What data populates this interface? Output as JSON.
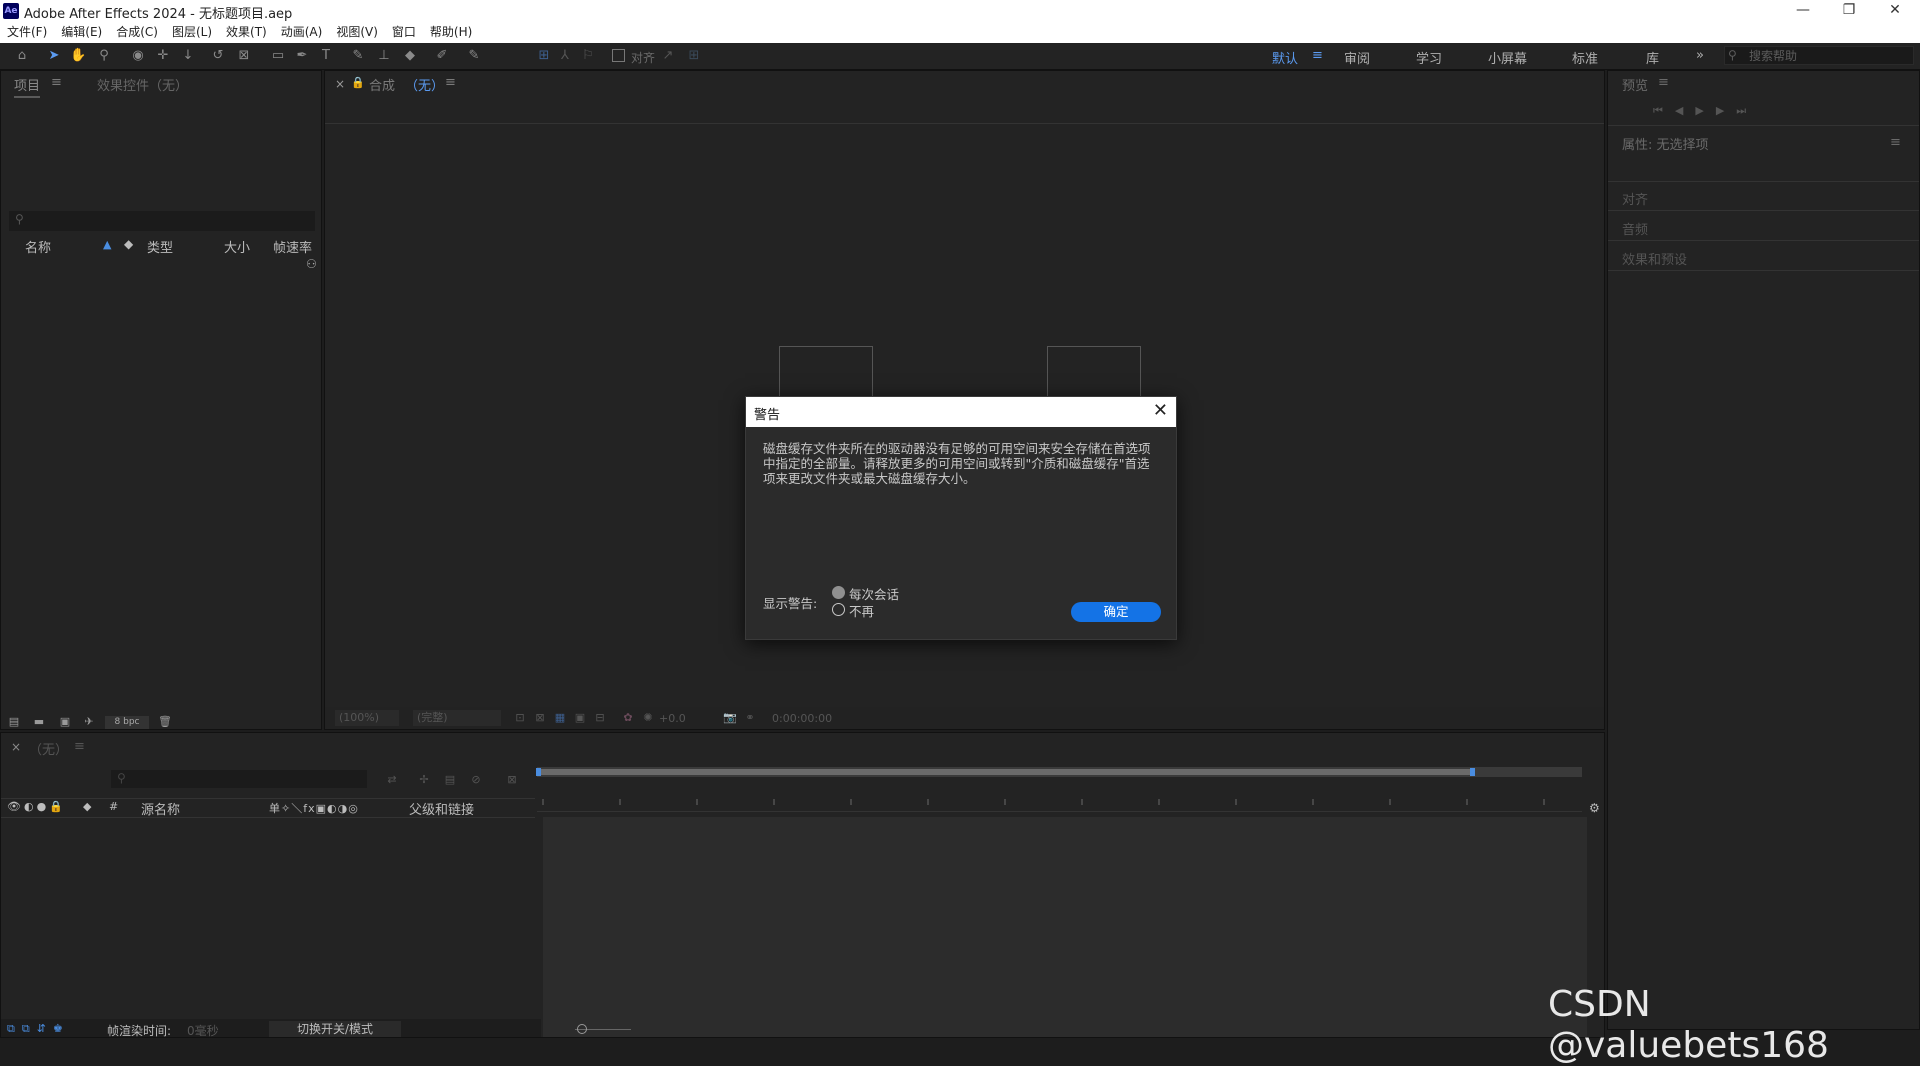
{
  "window": {
    "app_icon": "Ae",
    "title": "Adobe After Effects 2024 - 无标题项目.aep",
    "minimize": "—",
    "restore": "❐",
    "close": "✕"
  },
  "menu": [
    "文件(F)",
    "编辑(E)",
    "合成(C)",
    "图层(L)",
    "效果(T)",
    "动画(A)",
    "视图(V)",
    "窗口",
    "帮助(H)"
  ],
  "toolbar": {
    "align_label": "对齐",
    "workspaces": [
      "默认",
      "审阅",
      "学习",
      "小屏幕",
      "标准",
      "库"
    ],
    "more": "»",
    "search_placeholder": "搜索帮助"
  },
  "project_panel": {
    "tab_project": "项目",
    "tab_effects": "效果控件（无）",
    "columns": [
      "名称",
      "类型",
      "大小",
      "帧速率"
    ],
    "bpc": "8 bpc"
  },
  "comp_panel": {
    "tab_label": "合成",
    "tab_value": "（无）",
    "zoom": "(100%)",
    "quality": "(完整)",
    "exposure": "+0.0",
    "timecode": "0:00:00:00"
  },
  "right_panel": {
    "preview": "预览",
    "properties": "属性: 无选择项",
    "sections": [
      "对齐",
      "音频",
      "效果和预设"
    ]
  },
  "timeline": {
    "tab_label": "（无）",
    "columns": [
      "源名称",
      "父级和链接"
    ],
    "switch_icons": "单✧＼fx▣◐◑◎",
    "render_label": "帧渲染时间:",
    "render_value": "0毫秒",
    "toggle_label": "切换开关/模式"
  },
  "dialog": {
    "title": "警告",
    "message": "磁盘缓存文件夹所在的驱动器没有足够的可用空间来安全存储在首选项中指定的全部量。请释放更多的可用空间或转到\"介质和磁盘缓存\"首选项来更改文件夹或最大磁盘缓存大小。",
    "show_label": "显示警告:",
    "option_each": "每次会话",
    "option_never": "不再",
    "ok": "确定",
    "close": "✕"
  },
  "watermark": "CSDN @valuebets168",
  "colors": {
    "accent": "#1473e6",
    "workspace_active": "#5b9bf2"
  }
}
